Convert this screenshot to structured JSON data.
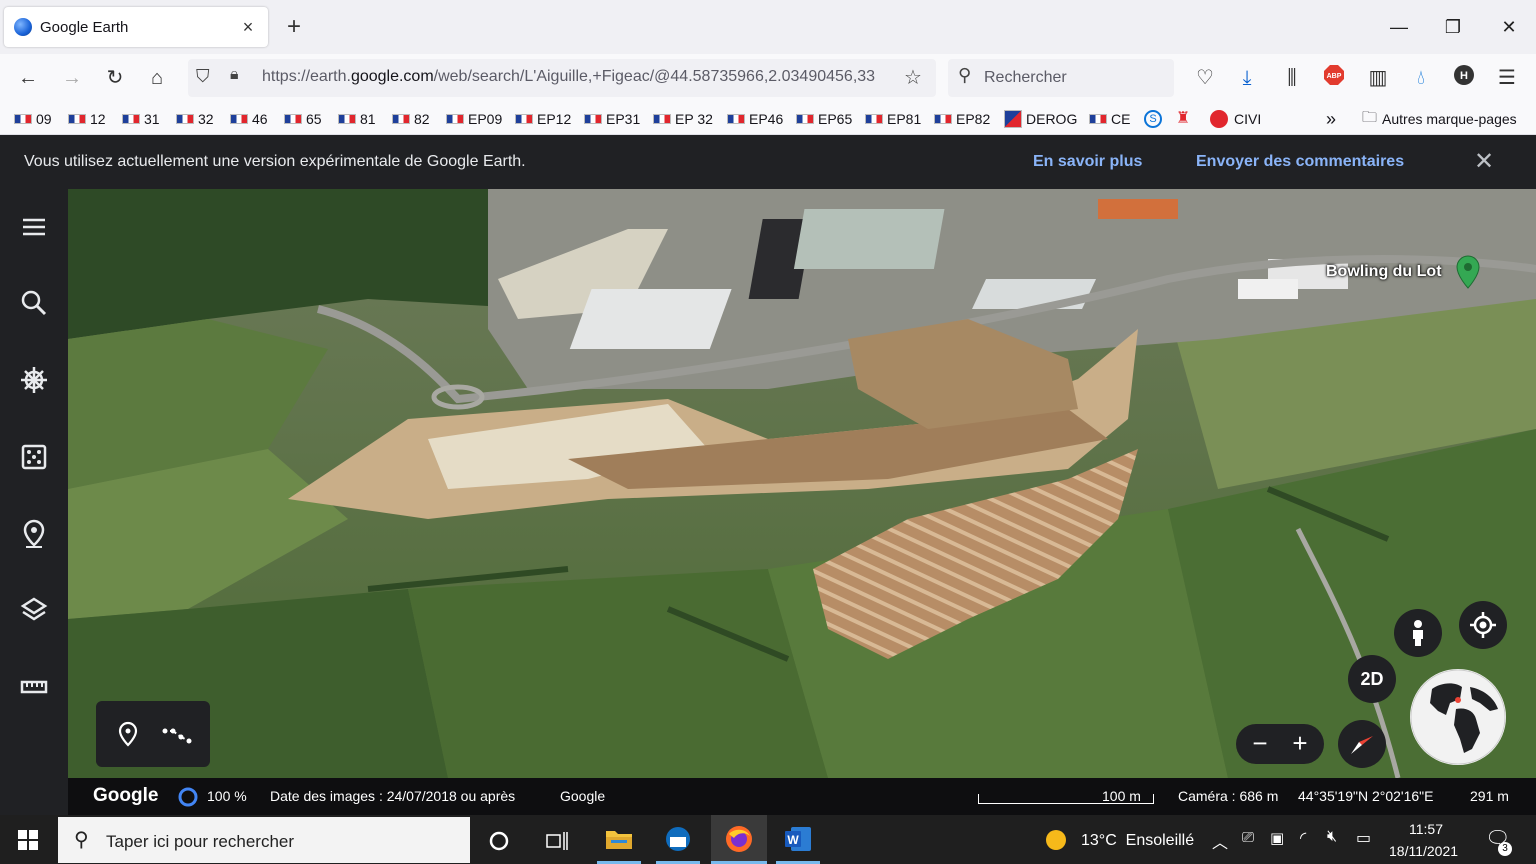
{
  "tab": {
    "title": "Google Earth",
    "close": "×",
    "new_tab": "+"
  },
  "window": {
    "minimize": "—",
    "restore": "❐",
    "close": "✕"
  },
  "nav": {
    "url_host_prefix": "https://earth.",
    "url_host": "google.com",
    "url_path": "/web/search/L'Aiguille,+Figeac/@44.58735966,2.03490456,33",
    "search_placeholder": "Rechercher"
  },
  "bookmarks": [
    {
      "label": "09"
    },
    {
      "label": "12"
    },
    {
      "label": "31"
    },
    {
      "label": "32"
    },
    {
      "label": "46"
    },
    {
      "label": "65"
    },
    {
      "label": "81"
    },
    {
      "label": "82"
    },
    {
      "label": "EP09"
    },
    {
      "label": "EP12"
    },
    {
      "label": "EP31"
    },
    {
      "label": "EP 32"
    },
    {
      "label": "EP46"
    },
    {
      "label": "EP65"
    },
    {
      "label": "EP81"
    },
    {
      "label": "EP82"
    },
    {
      "label": "DEROG"
    },
    {
      "label": "CE"
    },
    {
      "label": "CIVI"
    }
  ],
  "bookmarks_more": "»",
  "bookmarks_other": "Autres marque-pages",
  "banner": {
    "message": "Vous utilisez actuellement une version expérimentale de Google Earth.",
    "learn_more": "En savoir plus",
    "feedback": "Envoyer des commentaires",
    "close": "✕"
  },
  "map": {
    "place_label": "Bowling du Lot",
    "view_2d": "2D",
    "zoom_out": "−",
    "zoom_in": "+"
  },
  "status": {
    "brand": "Google",
    "load": "100 %",
    "imagery_date": "Date des images : 24/07/2018 ou après",
    "provider": "Google",
    "scale": "100 m",
    "camera": "Caméra : 686 m",
    "coords": "44°35'19\"N 2°02'16\"E",
    "elevation": "291 m"
  },
  "taskbar": {
    "search_placeholder": "Taper ici pour rechercher",
    "weather": "13°C  Ensoleillé",
    "time": "11:57",
    "date": "18/11/2021",
    "notifications": "3"
  },
  "colors": {
    "accent_link": "#8ab4f8",
    "rail_bg": "#202124",
    "pin": "#34a853"
  }
}
